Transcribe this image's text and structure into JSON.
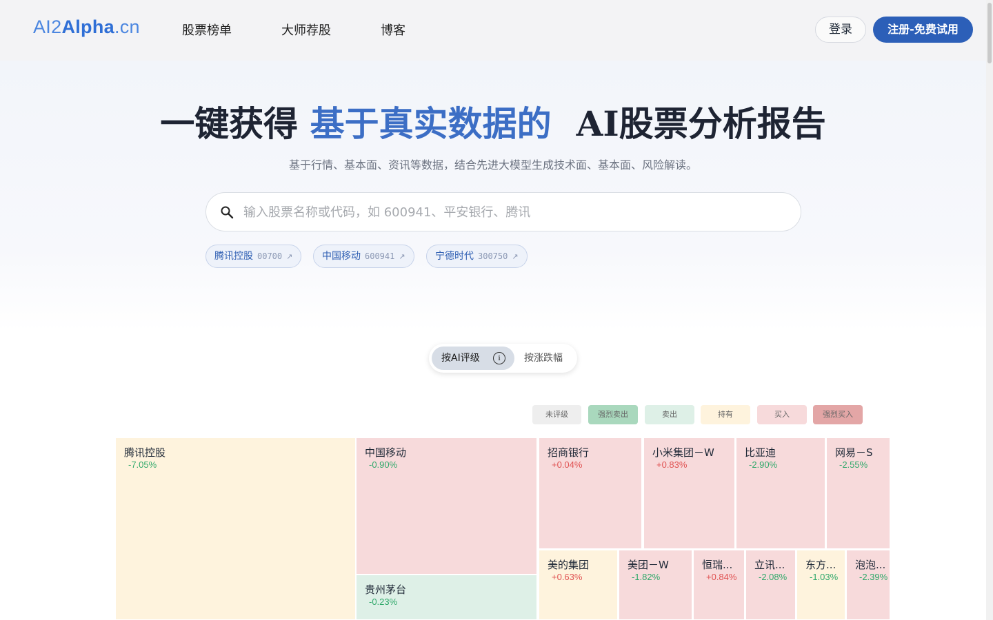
{
  "header": {
    "logo": {
      "part1": "AI2",
      "part2": "Alpha",
      "part3": ".cn"
    },
    "nav": [
      "股票榜单",
      "大师荐股",
      "博客"
    ],
    "login_label": "登录",
    "signup_label": "注册-免费试用"
  },
  "hero": {
    "title_plain": "一键获得",
    "title_accent": "基于真实数据的",
    "title_end": "AI股票分析报告",
    "subtitle": "基于行情、基本面、资讯等数据，结合先进大模型生成技术面、基本面、风险解读。",
    "search_placeholder": "输入股票名称或代码，如 600941、平安银行、腾讯",
    "chips": [
      {
        "name": "腾讯控股",
        "code": "00700"
      },
      {
        "name": "中国移动",
        "code": "600941"
      },
      {
        "name": "宁德时代",
        "code": "300750"
      }
    ]
  },
  "toggle": {
    "active": "按AI评级",
    "info_icon": "i",
    "inactive": "按涨跌幅"
  },
  "legend": [
    {
      "label": "未评级",
      "color": "#eeeeee"
    },
    {
      "label": "强烈卖出",
      "color": "#a9d8bd"
    },
    {
      "label": "卖出",
      "color": "#def0e7"
    },
    {
      "label": "持有",
      "color": "#fef3dd"
    },
    {
      "label": "买入",
      "color": "#f7dadb"
    },
    {
      "label": "强烈买入",
      "color": "#e3a6a6"
    }
  ],
  "treemap": [
    {
      "name": "腾讯控股",
      "change": "-7.05%",
      "rating": "持有"
    },
    {
      "name": "中国移动",
      "change": "-0.90%",
      "rating": "买入"
    },
    {
      "name": "贵州茅台",
      "change": "-0.23%",
      "rating": "卖出"
    },
    {
      "name": "招商银行",
      "change": "+0.04%",
      "rating": "买入"
    },
    {
      "name": "小米集团－W",
      "change": "+0.83%",
      "rating": "买入"
    },
    {
      "name": "比亚迪",
      "change": "-2.90%",
      "rating": "买入"
    },
    {
      "name": "网易－S",
      "change": "-2.55%",
      "rating": "买入"
    },
    {
      "name": "美的集团",
      "change": "+0.63%",
      "rating": "持有"
    },
    {
      "name": "美团－W",
      "change": "-1.82%",
      "rating": "买入"
    },
    {
      "name": "恒瑞...",
      "change": "+0.84%",
      "rating": "买入"
    },
    {
      "name": "立讯...",
      "change": "-2.08%",
      "rating": "买入"
    },
    {
      "name": "东方...",
      "change": "-1.03%",
      "rating": "持有"
    },
    {
      "name": "泡泡...",
      "change": "-2.39%",
      "rating": "买入"
    }
  ]
}
